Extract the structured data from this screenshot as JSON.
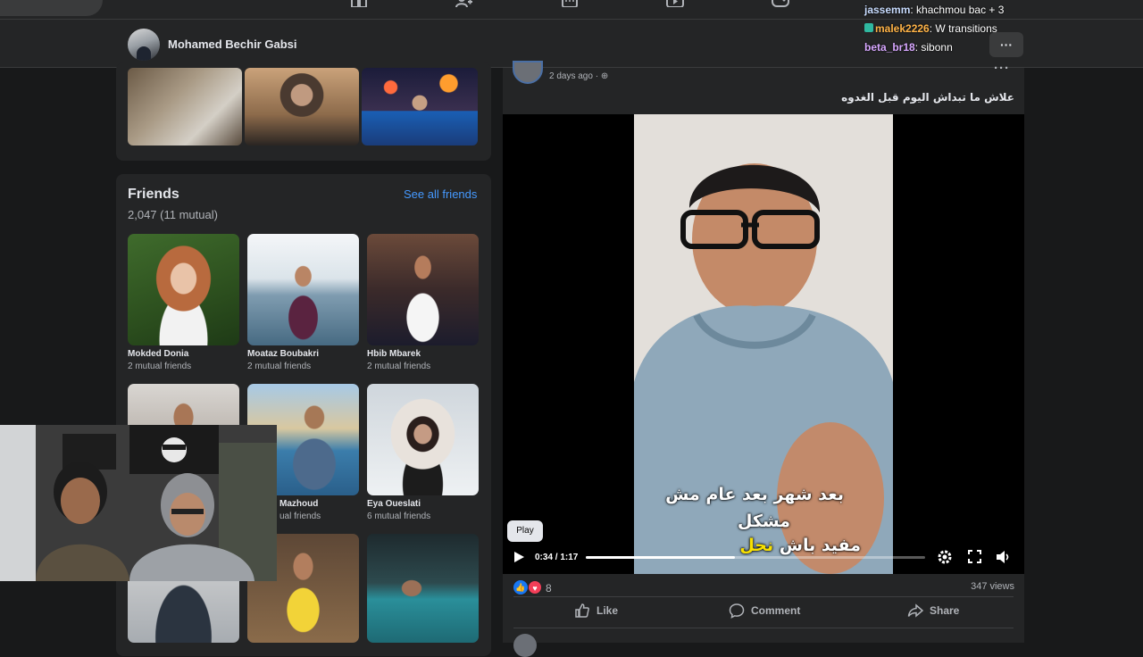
{
  "profile": {
    "name": "Mohamed Bechir Gabsi"
  },
  "friends": {
    "title": "Friends",
    "count": "2,047 (11 mutual)",
    "see_all": "See all friends",
    "items": [
      {
        "name": "Mokded Donia",
        "mutual": "2 mutual friends"
      },
      {
        "name": "Moataz Boubakri",
        "mutual": "2 mutual friends"
      },
      {
        "name": "Hbib Mbarek",
        "mutual": "2 mutual friends"
      },
      {
        "name": "Mazhoud",
        "mutual": "ual friends"
      },
      {
        "name": "Eya Oueslati",
        "mutual": "6 mutual friends"
      }
    ]
  },
  "post": {
    "time": "2 days ago ·",
    "text": "علاش ما تبداش اليوم قبل الغدوه",
    "subtitle_line1": "بعد شهر بعد عام مش",
    "subtitle_line2": "مشكل",
    "subtitle_line3_a": "مفيد باش ",
    "subtitle_line3_b": "نحل",
    "play_tooltip": "Play",
    "video_time": "0:34 / 1:17",
    "progress": 0.44,
    "reaction_count": "8",
    "views": "347 views",
    "actions": {
      "like": "Like",
      "comment": "Comment",
      "share": "Share"
    }
  },
  "chat": [
    {
      "user": "jassemm",
      "message": "khachmou bac + 3",
      "color": "#c8dcff"
    },
    {
      "user": "malek2226",
      "message": "W transitions",
      "color": "#ffb347"
    },
    {
      "user": "beta_br18",
      "message": "sibonn",
      "color": "#d7a7ff"
    }
  ],
  "colors": {
    "accent": "#4599ff",
    "like": "#1877f2",
    "love": "#f33e58",
    "card": "#242526",
    "page": "#18191a"
  }
}
